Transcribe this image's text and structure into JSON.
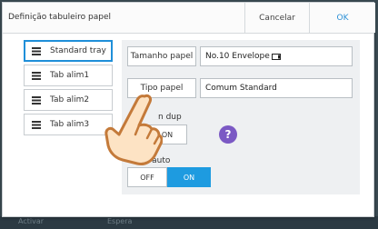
{
  "dialog": {
    "title": "Definição tabuleiro papel",
    "cancel_label": "Cancelar",
    "ok_label": "OK"
  },
  "sidebar": {
    "items": [
      {
        "label": "Standard tray",
        "selected": true,
        "icon": "tray-icon"
      },
      {
        "label": "Tab alim1",
        "selected": false,
        "icon": "tray-icon"
      },
      {
        "label": "Tab alim2",
        "selected": false,
        "icon": "tray-icon"
      },
      {
        "label": "Tab alim3",
        "selected": false,
        "icon": "tray-icon"
      }
    ]
  },
  "settings": {
    "paper_size_label": "Tamanho papel",
    "paper_size_value": "No.10 Envelope",
    "paper_type_label": "Tipo papel",
    "paper_type_value": "Comum Standard",
    "duplex_label": "n dup",
    "duplex_on": "ON",
    "help_symbol": "?",
    "auto_select_label": "Selec auto",
    "auto_off": "OFF",
    "auto_on": "ON",
    "auto_state": "ON"
  },
  "background": {
    "left_text": "Activar",
    "mid_text": "Espera"
  },
  "colors": {
    "accent": "#1e9be0",
    "help": "#7b59c4",
    "ok_text": "#2a8fd6"
  }
}
